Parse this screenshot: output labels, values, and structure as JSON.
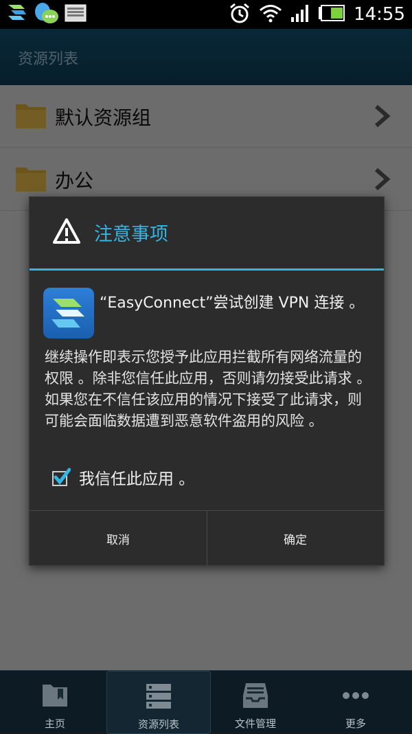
{
  "status_bar": {
    "time": "14:55",
    "icons_left": [
      "easyconnect-icon",
      "qq-icon",
      "picture-icon"
    ],
    "icons_right": [
      "alarm-icon",
      "wifi-icon",
      "signal-icon",
      "battery-icon"
    ]
  },
  "titlebar": {
    "title": "资源列表"
  },
  "list": {
    "items": [
      {
        "label": "默认资源组"
      },
      {
        "label": "办公"
      }
    ]
  },
  "dialog": {
    "title": "注意事项",
    "line1": "“EasyConnect”尝试创建 VPN 连接 。",
    "body": "继续操作即表示您授予此应用拦截所有网络流量的权限 。除非您信任此应用，否则请勿接受此请求 。如果您在不信任该应用的情况下接受了此请求，则可能会面临数据遭到恶意软件盗用的风险 。",
    "checkbox_label": "我信任此应用 。",
    "checkbox_checked": true,
    "cancel_label": "取消",
    "ok_label": "确定"
  },
  "bottom_nav": {
    "items": [
      {
        "label": "主页",
        "icon": "bookmark-folder-icon"
      },
      {
        "label": "资源列表",
        "icon": "list-icon"
      },
      {
        "label": "文件管理",
        "icon": "inbox-icon"
      },
      {
        "label": "更多",
        "icon": "more-icon"
      }
    ],
    "active_index": 1
  },
  "colors": {
    "accent": "#33b5e5",
    "titlebar": "#13506e"
  }
}
